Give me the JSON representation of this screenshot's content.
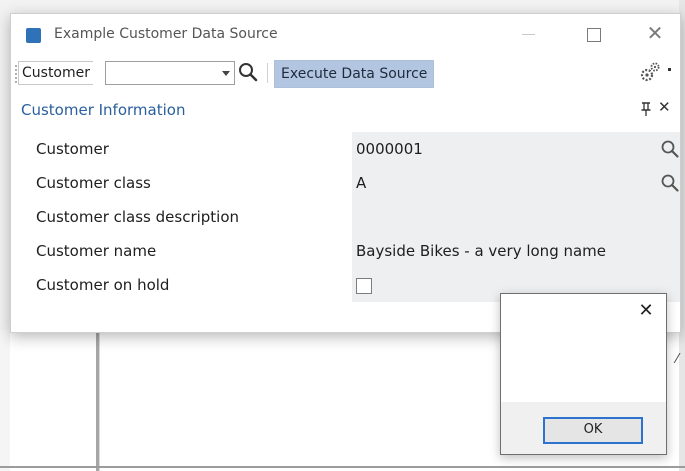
{
  "window": {
    "title": "Example Customer Data Source",
    "close_glyph": "✕"
  },
  "toolbar": {
    "customer_label": "Customer",
    "customer_value": "",
    "execute_label": "Execute Data Source"
  },
  "section": {
    "title": "Customer Information",
    "close_glyph": "✕"
  },
  "properties": [
    {
      "label": "Customer",
      "value": "0000001",
      "lookup": true
    },
    {
      "label": "Customer class",
      "value": "A",
      "lookup": true
    },
    {
      "label": "Customer class description",
      "value": "",
      "lookup": false
    },
    {
      "label": "Customer name",
      "value": "Bayside Bikes - a very long name",
      "lookup": false
    },
    {
      "label": "Customer on hold",
      "value": "",
      "checkbox": true,
      "checked": false
    }
  ],
  "message_box": {
    "close_glyph": "✕",
    "ok_label": "OK"
  },
  "icons": {
    "app": "app-icon",
    "search": "search-icon",
    "settings": "gear-icon",
    "pin": "pin-icon"
  },
  "colors": {
    "accent": "#2a5f9e",
    "execute_button_bg": "#b2c6e2",
    "value_cell_bg": "#edeff1",
    "app_icon": "#2f72b8"
  }
}
